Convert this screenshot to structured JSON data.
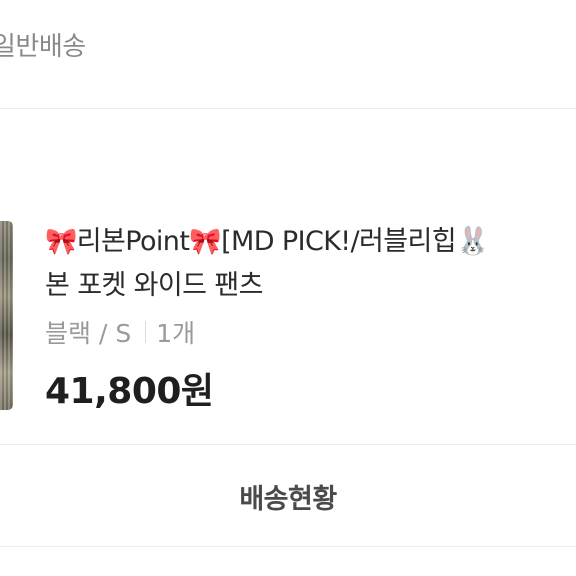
{
  "shipping": {
    "type_label": "일반배송"
  },
  "product": {
    "name_line1_prefix": "🎀",
    "name_line1_text_a": "리본Point",
    "name_line1_ribbon2": "🎀",
    "name_line1_text_b": "[MD PICK!/러블리힙",
    "name_line1_emoji": "🐰",
    "name_line2": "본 포켓 와이드 팬츠",
    "option": "블랙 / S",
    "quantity": "1개",
    "price": "41,800원"
  },
  "actions": {
    "tracking_label": "배송현황"
  },
  "colors": {
    "price": "#1f1f1f",
    "muted": "#9a9a9a",
    "divider": "#ececec"
  },
  "icons": {
    "thumbnail": "product-thumbnail-image"
  }
}
